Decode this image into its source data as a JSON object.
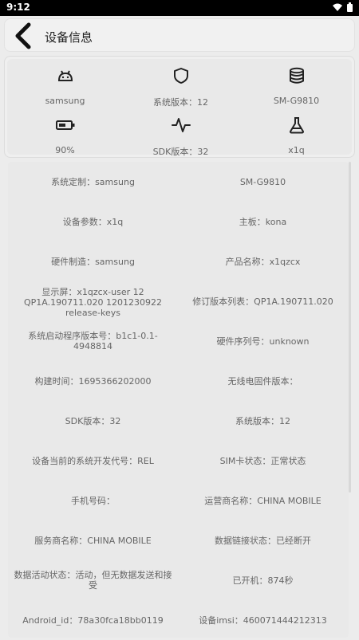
{
  "status": {
    "time": "9:12"
  },
  "header": {
    "title": "设备信息"
  },
  "summary": [
    {
      "icon": "android-icon",
      "label": "samsung"
    },
    {
      "icon": "shield-icon",
      "label": "系统版本：12"
    },
    {
      "icon": "database-icon",
      "label": "SM-G9810"
    },
    {
      "icon": "battery-icon",
      "label": "90%"
    },
    {
      "icon": "pulse-icon",
      "label": "SDK版本：32"
    },
    {
      "icon": "flask-icon",
      "label": "x1q"
    }
  ],
  "details": [
    [
      "系统定制：samsung",
      "SM-G9810"
    ],
    [
      "设备参数：x1q",
      "主板：kona"
    ],
    [
      "硬件制造：samsung",
      "产品名称：x1qzcx"
    ],
    [
      "显示屏：x1qzcx-user 12 QP1A.190711.020 1201230922 release-keys",
      "修订版本列表：QP1A.190711.020"
    ],
    [
      "系统启动程序版本号：b1c1-0.1-4948814",
      "硬件序列号：unknown"
    ],
    [
      "构建时间：1695366202000",
      "无线电固件版本："
    ],
    [
      "SDK版本：32",
      "系统版本：12"
    ],
    [
      "设备当前的系统开发代号：REL",
      "SIM卡状态：正常状态"
    ],
    [
      "手机号码：",
      "运营商名称：CHINA MOBILE"
    ],
    [
      "服务商名称：CHINA MOBILE",
      "数据链接状态：已经断开"
    ],
    [
      "数据活动状态：活动，但无数据发送和接受",
      "已开机：874秒"
    ],
    [
      "Android_id：78a30fca18bb0119",
      "设备imsi：460071444212313"
    ]
  ]
}
